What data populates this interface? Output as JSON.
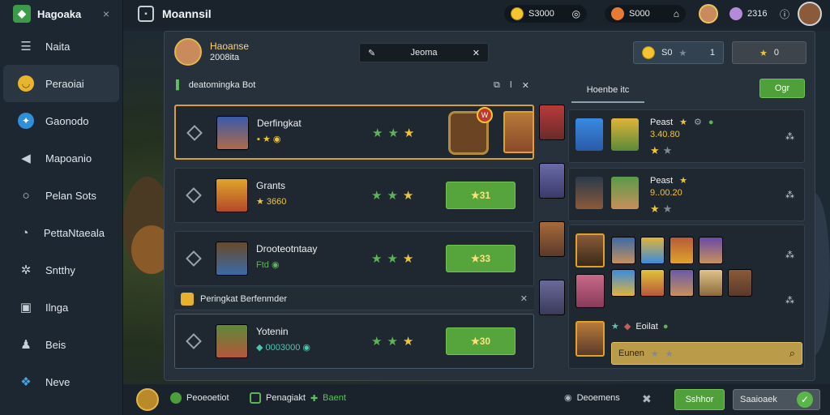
{
  "sidebar": {
    "brand": "Hagoaka",
    "close": "×",
    "items": [
      {
        "label": "Naita",
        "icon": "list-icon"
      },
      {
        "label": "Peraoiai",
        "icon": "gold-coin-icon"
      },
      {
        "label": "Gaonodo",
        "icon": "blue-gear-icon"
      },
      {
        "label": "Mapoanio",
        "icon": "flag-icon"
      },
      {
        "label": "Pelan Sots",
        "icon": "chat-icon"
      },
      {
        "label": "PettaNtaeala",
        "icon": "bubble-icon"
      },
      {
        "label": "Sntthy",
        "icon": "gear-icon"
      },
      {
        "label": "Ilnga",
        "icon": "image-icon"
      },
      {
        "label": "Beis",
        "icon": "people-icon"
      },
      {
        "label": "Neve",
        "icon": "puzzle-icon"
      }
    ]
  },
  "topbar": {
    "title": "Moannsil",
    "coins": "S3000",
    "gems": "S000",
    "pearls": "2316"
  },
  "panel": {
    "player_name": "Haoanse",
    "player_sub": "2008ita",
    "search_title": "Jeoma",
    "stat1": "S0",
    "stat1_num": "1",
    "stat2": "0",
    "section_title": "deatomingka Bot",
    "rows": [
      {
        "name": "Derfingkat",
        "score": "",
        "action": ""
      },
      {
        "name": "Grants",
        "score": "3660",
        "action": "31"
      },
      {
        "name": "Drooteotntaay",
        "score": "",
        "action": "33"
      },
      {
        "name": "Yotenin",
        "score": "0003000",
        "action": "30"
      }
    ],
    "sub_header": "Peringkat Berfenmder",
    "right_tab": "Hoenbe itc",
    "right_btn": "Ogr",
    "right_cards": [
      {
        "label": "Peast",
        "value": "3.40.80"
      },
      {
        "label": "Peast",
        "value": "9..00.20"
      }
    ],
    "right_bottom_label": "Eoilat",
    "right_search": "Eunen"
  },
  "bottombar": {
    "item1": "Peoeoetiot",
    "item2": "Penagiakt",
    "item3": "Baent",
    "item4": "Deoemens",
    "btn_green": "Sshhor",
    "btn_gray": "Saaioaek"
  }
}
